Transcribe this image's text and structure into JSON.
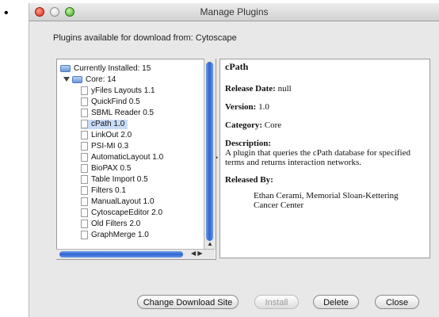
{
  "page": {
    "bullet": "•"
  },
  "window": {
    "title": "Manage Plugins"
  },
  "source_label": "Plugins available for download from:  Cytoscape",
  "tree": {
    "items": [
      {
        "label": "Currently Installed: 15"
      },
      {
        "label": "Core: 14"
      },
      {
        "label": "yFiles Layouts 1.1"
      },
      {
        "label": "QuickFind 0.5"
      },
      {
        "label": "SBML Reader 0.5"
      },
      {
        "label": "cPath 1.0"
      },
      {
        "label": "LinkOut 2.0"
      },
      {
        "label": "PSI-MI 0.3"
      },
      {
        "label": "AutomaticLayout 1.0"
      },
      {
        "label": "BioPAX 0.5"
      },
      {
        "label": "Table Import 0.5"
      },
      {
        "label": "Filters 0.1"
      },
      {
        "label": "ManualLayout 1.0"
      },
      {
        "label": "CytoscapeEditor 2.0"
      },
      {
        "label": "Old Filters 2.0"
      },
      {
        "label": "GraphMerge 1.0"
      }
    ],
    "selected": "cPath 1.0"
  },
  "details": {
    "name": "cPath",
    "release_date_label": "Release Date:",
    "release_date": "null",
    "version_label": "Version:",
    "version": "1.0",
    "category_label": "Category:",
    "category": "Core",
    "description_label": "Description:",
    "description": "A plugin that queries the cPath database for specified terms and returns interaction networks.",
    "released_by_label": "Released By:",
    "released_by": "Ethan Cerami, Memorial Sloan-Kettering Cancer Center"
  },
  "buttons": {
    "change_site": "Change Download Site",
    "install": "Install",
    "delete": "Delete",
    "close": "Close"
  }
}
